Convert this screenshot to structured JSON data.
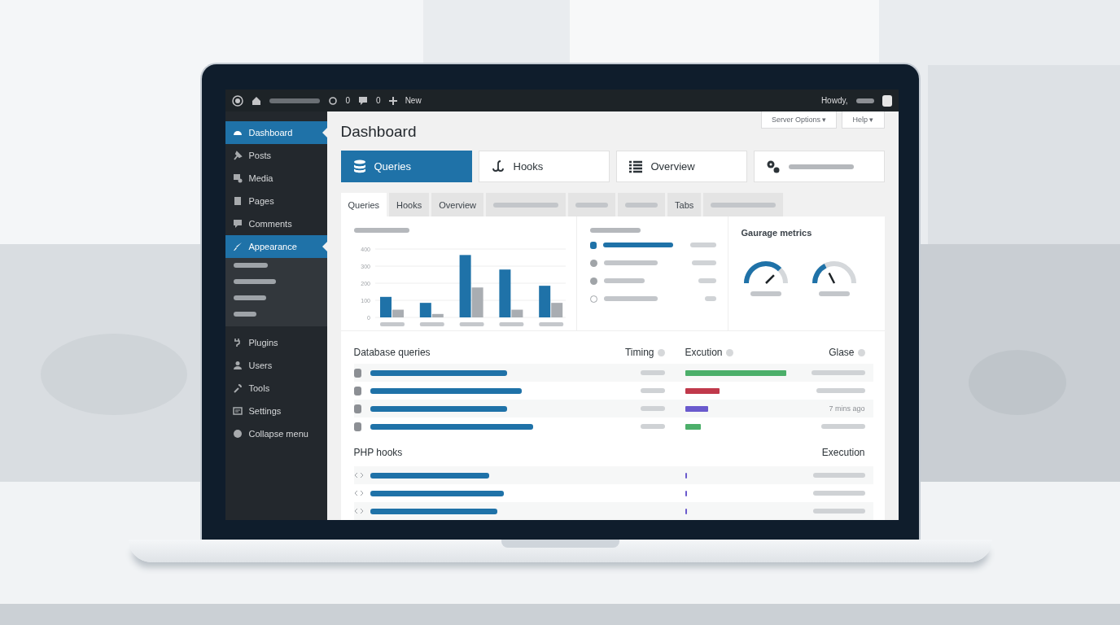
{
  "admin_bar": {
    "updates": "0",
    "comments": "0",
    "new_label": "New",
    "greeting": "Howdy,"
  },
  "sidebar": {
    "items": [
      {
        "label": "Dashboard",
        "kind": "gauge",
        "selected": true,
        "expanded": false
      },
      {
        "label": "Posts",
        "kind": "pin",
        "selected": false,
        "expanded": false
      },
      {
        "label": "Media",
        "kind": "media",
        "selected": false,
        "expanded": false
      },
      {
        "label": "Pages",
        "kind": "pages",
        "selected": false,
        "expanded": false
      },
      {
        "label": "Comments",
        "kind": "comment",
        "selected": false,
        "expanded": false
      },
      {
        "label": "Appearance",
        "kind": "brush",
        "selected": true,
        "expanded": true
      },
      {
        "label": "Plugins",
        "kind": "plug",
        "selected": false,
        "expanded": false
      },
      {
        "label": "Users",
        "kind": "user",
        "selected": false,
        "expanded": false
      },
      {
        "label": "Tools",
        "kind": "wrench",
        "selected": false,
        "expanded": false
      },
      {
        "label": "Settings",
        "kind": "settings",
        "selected": false,
        "expanded": false
      },
      {
        "label": "Collapse menu",
        "kind": "collapse",
        "selected": false,
        "expanded": false
      }
    ]
  },
  "page_title": "Dashboard",
  "header_buttons": [
    "Server Options ▾",
    "Help ▾"
  ],
  "tiles": [
    {
      "label": "Queries",
      "kind": "database",
      "selected": true
    },
    {
      "label": "Hooks",
      "kind": "hook",
      "selected": false
    },
    {
      "label": "Overview",
      "kind": "list",
      "selected": false
    },
    {
      "kind": "gears",
      "selected": false
    }
  ],
  "tabs": [
    {
      "label": "Queries",
      "selected": true
    },
    {
      "label": "Hooks",
      "selected": false
    },
    {
      "label": "Overview",
      "selected": false
    },
    {
      "selected": false
    },
    {
      "selected": false
    },
    {
      "selected": false
    },
    {
      "label": "Tabs",
      "selected": false
    },
    {
      "selected": false
    }
  ],
  "chart_panel": {
    "chart_data": {
      "type": "bar",
      "grid": true,
      "yticks": [
        0,
        100,
        200,
        300,
        400
      ],
      "ylim": [
        0,
        400
      ],
      "series": [
        {
          "color": "#1f72a8",
          "values": [
            120,
            85,
            365,
            280,
            185
          ]
        },
        {
          "color": "#a9adb2",
          "values": [
            45,
            20,
            175,
            45,
            85
          ]
        }
      ]
    }
  },
  "legend_panel": {
    "items": [
      {
        "kind": "square"
      },
      {
        "kind": "dot"
      },
      {
        "kind": "dot"
      },
      {
        "kind": "ring"
      }
    ]
  },
  "gauge_panel": {
    "title": "Gaurage metrics"
  },
  "queries": {
    "columns": [
      "Database queries",
      "Timing",
      "Excution",
      "Glase"
    ],
    "rows": [
      {
        "color": "#4caf6a"
      },
      {
        "color": "#c0394b"
      },
      {
        "color": "#6a5acd",
        "age": "7 mins ago"
      },
      {
        "color": "#4caf6a"
      }
    ]
  },
  "hooks": {
    "title": "PHP hooks",
    "column": "Execution"
  }
}
